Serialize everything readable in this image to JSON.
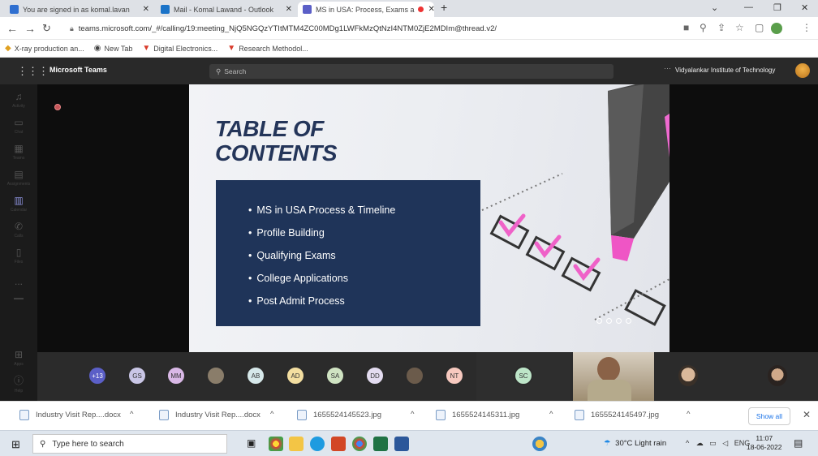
{
  "browser": {
    "tabs": [
      {
        "title": "You are signed in as komal.lavan",
        "active": false,
        "favicon_color": "#2f6fd0"
      },
      {
        "title": "Mail - Komal Lawand - Outlook",
        "active": false,
        "favicon_color": "#1a73c8"
      },
      {
        "title": "MS in USA: Process, Exams a",
        "active": true,
        "favicon_color": "#5b5fc7"
      }
    ],
    "new_tab": "+",
    "url": "teams.microsoft.com/_#/calling/19:meeting_NjQ5NGQzYTItMTM4ZC00MDg1LWFkMzQtNzI4NTM0ZjE2MDIm@thread.v2/",
    "bookmarks": [
      {
        "label": "X-ray production an...",
        "icon": "bookmark-icon"
      },
      {
        "label": "New Tab",
        "icon": "globe-icon"
      },
      {
        "label": "Digital Electronics...",
        "icon": "v-icon"
      },
      {
        "label": "Research Methodol...",
        "icon": "v-icon"
      }
    ]
  },
  "teams": {
    "app_name": "Microsoft Teams",
    "search_placeholder": "Search",
    "org": "Vidyalankar Institute of Technology",
    "org_dots": "···",
    "rail": [
      {
        "label": "Activity",
        "icon": "bell-icon"
      },
      {
        "label": "Chat",
        "icon": "chat-icon"
      },
      {
        "label": "Teams",
        "icon": "teams-icon"
      },
      {
        "label": "Assignments",
        "icon": "assignments-icon"
      },
      {
        "label": "Calendar",
        "icon": "calendar-icon"
      },
      {
        "label": "Calls",
        "icon": "phone-icon"
      },
      {
        "label": "Files",
        "icon": "file-icon"
      },
      {
        "label": "...",
        "icon": "more-icon"
      },
      {
        "label": "",
        "icon": "divider-icon"
      },
      {
        "label": "Apps",
        "icon": "apps-icon"
      },
      {
        "label": "Help",
        "icon": "help-icon"
      }
    ]
  },
  "slide": {
    "title_line1": "TABLE OF",
    "title_line2": "CONTENTS",
    "items": [
      "MS in USA Process & Timeline",
      "Profile Building",
      "Qualifying Exams",
      "College Applications",
      "Post Admit Process"
    ],
    "accent_color": "#1f3459"
  },
  "participants": [
    {
      "initials": "+13",
      "color": "#5b5fc7",
      "text_color": "#ffffff"
    },
    {
      "initials": "GS",
      "color": "#c9c6e6",
      "text_color": "#333333"
    },
    {
      "initials": "MM",
      "color": "#d9b8e6",
      "text_color": "#333333"
    },
    {
      "initials": "",
      "color": "#8a7d6a",
      "text_color": "#333333"
    },
    {
      "initials": "AB",
      "color": "#d6e8ea",
      "text_color": "#333333"
    },
    {
      "initials": "AD",
      "color": "#f3dea0",
      "text_color": "#333333"
    },
    {
      "initials": "SA",
      "color": "#cfe3c2",
      "text_color": "#333333"
    },
    {
      "initials": "DD",
      "color": "#e3dcf0",
      "text_color": "#333333"
    },
    {
      "initials": "",
      "color": "#6b5b4b",
      "text_color": "#333333"
    },
    {
      "initials": "NT",
      "color": "#f7c9bf",
      "text_color": "#333333"
    },
    {
      "initials": "SC",
      "color": "#bde5c8",
      "text_color": "#333333"
    }
  ],
  "downloads": [
    {
      "name": "Industry Visit Rep....docx",
      "type": "docx"
    },
    {
      "name": "Industry Visit Rep....docx",
      "type": "docx"
    },
    {
      "name": "1655524145523.jpg",
      "type": "jpg"
    },
    {
      "name": "1655524145311.jpg",
      "type": "jpg"
    },
    {
      "name": "1655524145497.jpg",
      "type": "jpg"
    }
  ],
  "downloads_show_all": "Show all",
  "taskbar": {
    "search_placeholder": "Type here to search",
    "weather": "30°C  Light rain",
    "lang": "ENG",
    "time": "11:07",
    "date": "18-06-2022"
  }
}
